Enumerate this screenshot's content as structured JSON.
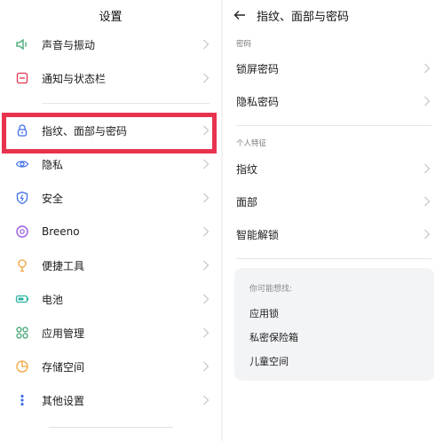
{
  "left": {
    "title": "设置",
    "items": [
      {
        "label": "声音与振动",
        "icon": "speaker-icon"
      },
      {
        "label": "通知与状态栏",
        "icon": "notification-icon"
      },
      {
        "label": "指纹、面部与密码",
        "icon": "lock-icon"
      },
      {
        "label": "隐私",
        "icon": "privacy-eye-icon"
      },
      {
        "label": "安全",
        "icon": "shield-icon"
      },
      {
        "label": "Breeno",
        "icon": "breeno-ring-icon"
      },
      {
        "label": "便捷工具",
        "icon": "tools-icon"
      },
      {
        "label": "电池",
        "icon": "battery-icon"
      },
      {
        "label": "应用管理",
        "icon": "apps-grid-icon"
      },
      {
        "label": "存储空间",
        "icon": "storage-pie-icon"
      },
      {
        "label": "其他设置",
        "icon": "more-dots-icon"
      }
    ]
  },
  "right": {
    "title": "指纹、面部与密码",
    "password_section": {
      "title": "密码",
      "items": [
        "锁屏密码",
        "隐私密码"
      ]
    },
    "personal_section": {
      "title": "个人特征",
      "items": [
        "指纹",
        "面部",
        "智能解锁"
      ]
    },
    "suggestions": {
      "title": "你可能想找:",
      "links": [
        "应用锁",
        "私密保险箱",
        "儿童空间"
      ]
    }
  },
  "colors": {
    "highlight": "#e8334f",
    "icon_accent": "#3aa36c",
    "lock_blue": "#3e6ee8"
  }
}
